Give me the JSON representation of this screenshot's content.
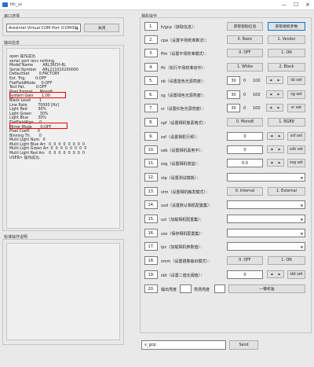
{
  "window": {
    "title": "tfc_ui",
    "min": "—",
    "max": "☐",
    "close": "✕"
  },
  "left": {
    "serial_group": "串口选择",
    "port_value": "AresIntel Virtual COM Port (COM39)",
    "close_button": "关闭",
    "output_group": "输出信息",
    "output_lines": [
      "open 操作成功.",
      "serial_port recv nothing.",
      "",
      "Model Name        ARL36CH-8L",
      "Serial Number     ARL221020200000",
      "",
      "DefaultSet        0:FACTORY",
      "Ext. Trig.        0:OFF",
      "FlatFieldMode     0:OFF",
      "Test Pat.         0:OFF",
      "Pixel Format      Mono8",
      "System Gain       1.00",
      "Black Level       1",
      "Line Rate         70000 [Hz]",
      "Light Red         30%",
      "Light Green       30%",
      "Light Blue        30%",
      "FlatFieldAlgo.    0",
      "Mirror Mode       0:OFF",
      "Pixel Coeff.      0",
      "Binning Th.       0",
      "Multi Light Num.  0",
      "Multi Light Blue Arr.  0  0  0  0  0  0  0  0",
      "Multi Light Green Arr. 0  0  0  0  0  0  0  0",
      "Multi Light Red Arr.   0  0  0  0  0  0  0  0",
      "",
      "USER> 操作成功."
    ],
    "instructions_group": "标准操作说明"
  },
  "right": {
    "group_title": "相机操作",
    "rows": [
      {
        "num": "1.",
        "label": "h/gcp（获取信息）：",
        "b1": "获取帮助信息",
        "b2": "获取相机参数"
      },
      {
        "num": "2.",
        "label": "cpa（设置平场校准算法）：",
        "b1": "0. Basic",
        "b2": "1. Vendor"
      },
      {
        "num": "3.",
        "label": "ffm（设置平场校准模式）：",
        "b1": "0. OFF",
        "b2": "1. ON"
      },
      {
        "num": "4.",
        "label": "ffc（执行平场校准动作）：",
        "b1": "1. White",
        "b2": "2. Black"
      },
      {
        "num": "5.",
        "label": "sb（设置蓝色光源亮度）：",
        "v": "30",
        "z": "0",
        "h": "100",
        "set": "sb set"
      },
      {
        "num": "6.",
        "label": "sg（设置绿色光源亮度）：",
        "v": "30",
        "z": "0",
        "h": "100",
        "set": "sg set"
      },
      {
        "num": "7.",
        "label": "sr（设置红色光源亮度）：",
        "v": "30",
        "z": "0",
        "h": "100",
        "set": "sr set"
      },
      {
        "num": "8.",
        "label": "spf（设置相机像素格式）：",
        "b1": "0. Mono8",
        "b2": "1. RGB8"
      },
      {
        "num": "9.",
        "label": "ssf（设置相机行频）：",
        "v": "0",
        "set": "ssf set"
      },
      {
        "num": "10.",
        "label": "ssb（设置相机黑电平）：",
        "v": "0",
        "set": "ssb set"
      },
      {
        "num": "11.",
        "label": "ssg（设置相机增益）：",
        "v": "0.0",
        "set": "ssg set"
      },
      {
        "num": "12.",
        "label": "stp（设置测试模板）："
      },
      {
        "num": "13.",
        "label": "stm（设置相机触发模式）：",
        "b1": "0. Internal",
        "b2": "1. External"
      },
      {
        "num": "14.",
        "label": "usd（设置默认相机配置集）："
      },
      {
        "num": "15.",
        "label": "usl（加载相机配置集）："
      },
      {
        "num": "16.",
        "label": "uss（保存相机配置集）："
      },
      {
        "num": "17.",
        "label": "lpc（加载相机参数值）："
      },
      {
        "num": "18.",
        "label": "smm（设置镜像输出模式）：",
        "b1": "0. OFF",
        "b2": "1. ON"
      },
      {
        "num": "19.",
        "label": "sbt（设置二值化阈值）：",
        "v": "0",
        "set": "sbt set"
      },
      {
        "num": "20.",
        "label_a": "输出亮度",
        "label_b": "亮场亮度",
        "action": "一键校准"
      }
    ],
    "command_value": "v_gcp",
    "send_button": "Send"
  }
}
